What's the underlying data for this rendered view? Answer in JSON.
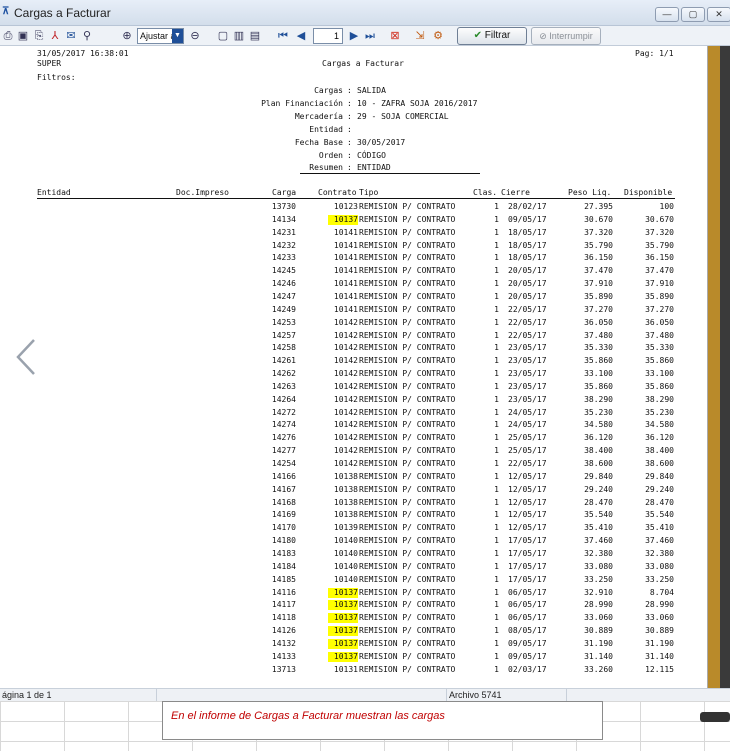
{
  "window": {
    "title": "Cargas a Facturar",
    "controls": [
      "—",
      "▢",
      "✕"
    ]
  },
  "toolbar": {
    "zoom_value": "Ajustar á",
    "page_number": "1",
    "filtrar_label": "Filtrar",
    "interrumpir_label": "Interrumpir"
  },
  "report": {
    "date_time": "31/05/2017 16:38:01",
    "user": "SUPER",
    "title": "Cargas a Facturar",
    "page": "Pag: 1/1",
    "filtros_label": "Filtros:",
    "filters": [
      {
        "label": "Cargas",
        "value": "SALIDA"
      },
      {
        "label": "Plan Financiación",
        "value": "10 - ZAFRA SOJA 2016/2017"
      },
      {
        "label": "Mercadería",
        "value": "29 - SOJA COMERCIAL"
      },
      {
        "label": "Entidad",
        "value": ""
      },
      {
        "label": "Fecha Base",
        "value": "30/05/2017"
      },
      {
        "label": "Orden",
        "value": "CÓDIGO"
      },
      {
        "label": "Resumen",
        "value": "ENTIDAD"
      }
    ],
    "columns": {
      "entidad": "Entidad",
      "doc": "Doc.Impreso",
      "carga": "Carga",
      "contrato": "Contrato",
      "tipo": "Tipo",
      "clas": "Clas.",
      "cierre": "Cierre",
      "peso": "Peso Liq.",
      "disponible": "Disponible"
    },
    "rows": [
      [
        "13730",
        "10123",
        "REMISION P/ CONTRATO",
        "1",
        "28/02/17",
        "27.395",
        "100",
        false
      ],
      [
        "14134",
        "10137",
        "REMISION P/ CONTRATO",
        "1",
        "09/05/17",
        "30.670",
        "30.670",
        true
      ],
      [
        "14231",
        "10141",
        "REMISION P/ CONTRATO",
        "1",
        "18/05/17",
        "37.320",
        "37.320",
        false
      ],
      [
        "14232",
        "10141",
        "REMISION P/ CONTRATO",
        "1",
        "18/05/17",
        "35.790",
        "35.790",
        false
      ],
      [
        "14233",
        "10141",
        "REMISION P/ CONTRATO",
        "1",
        "18/05/17",
        "36.150",
        "36.150",
        false
      ],
      [
        "14245",
        "10141",
        "REMISION P/ CONTRATO",
        "1",
        "20/05/17",
        "37.470",
        "37.470",
        false
      ],
      [
        "14246",
        "10141",
        "REMISION P/ CONTRATO",
        "1",
        "20/05/17",
        "37.910",
        "37.910",
        false
      ],
      [
        "14247",
        "10141",
        "REMISION P/ CONTRATO",
        "1",
        "20/05/17",
        "35.890",
        "35.890",
        false
      ],
      [
        "14249",
        "10141",
        "REMISION P/ CONTRATO",
        "1",
        "22/05/17",
        "37.270",
        "37.270",
        false
      ],
      [
        "14253",
        "10142",
        "REMISION P/ CONTRATO",
        "1",
        "22/05/17",
        "36.050",
        "36.050",
        false
      ],
      [
        "14257",
        "10142",
        "REMISION P/ CONTRATO",
        "1",
        "22/05/17",
        "37.480",
        "37.480",
        false
      ],
      [
        "14258",
        "10142",
        "REMISION P/ CONTRATO",
        "1",
        "23/05/17",
        "35.330",
        "35.330",
        false
      ],
      [
        "14261",
        "10142",
        "REMISION P/ CONTRATO",
        "1",
        "23/05/17",
        "35.860",
        "35.860",
        false
      ],
      [
        "14262",
        "10142",
        "REMISION P/ CONTRATO",
        "1",
        "23/05/17",
        "33.100",
        "33.100",
        false
      ],
      [
        "14263",
        "10142",
        "REMISION P/ CONTRATO",
        "1",
        "23/05/17",
        "35.860",
        "35.860",
        false
      ],
      [
        "14264",
        "10142",
        "REMISION P/ CONTRATO",
        "1",
        "23/05/17",
        "38.290",
        "38.290",
        false
      ],
      [
        "14272",
        "10142",
        "REMISION P/ CONTRATO",
        "1",
        "24/05/17",
        "35.230",
        "35.230",
        false
      ],
      [
        "14274",
        "10142",
        "REMISION P/ CONTRATO",
        "1",
        "24/05/17",
        "34.580",
        "34.580",
        false
      ],
      [
        "14276",
        "10142",
        "REMISION P/ CONTRATO",
        "1",
        "25/05/17",
        "36.120",
        "36.120",
        false
      ],
      [
        "14277",
        "10142",
        "REMISION P/ CONTRATO",
        "1",
        "25/05/17",
        "38.400",
        "38.400",
        false
      ],
      [
        "14254",
        "10142",
        "REMISION P/ CONTRATO",
        "1",
        "22/05/17",
        "38.600",
        "38.600",
        false
      ],
      [
        "14166",
        "10138",
        "REMISION P/ CONTRATO",
        "1",
        "12/05/17",
        "29.840",
        "29.840",
        false
      ],
      [
        "14167",
        "10138",
        "REMISION P/ CONTRATO",
        "1",
        "12/05/17",
        "29.240",
        "29.240",
        false
      ],
      [
        "14168",
        "10138",
        "REMISION P/ CONTRATO",
        "1",
        "12/05/17",
        "28.470",
        "28.470",
        false
      ],
      [
        "14169",
        "10138",
        "REMISION P/ CONTRATO",
        "1",
        "12/05/17",
        "35.540",
        "35.540",
        false
      ],
      [
        "14170",
        "10139",
        "REMISION P/ CONTRATO",
        "1",
        "12/05/17",
        "35.410",
        "35.410",
        false
      ],
      [
        "14180",
        "10140",
        "REMISION P/ CONTRATO",
        "1",
        "17/05/17",
        "37.460",
        "37.460",
        false
      ],
      [
        "14183",
        "10140",
        "REMISION P/ CONTRATO",
        "1",
        "17/05/17",
        "32.380",
        "32.380",
        false
      ],
      [
        "14184",
        "10140",
        "REMISION P/ CONTRATO",
        "1",
        "17/05/17",
        "33.080",
        "33.080",
        false
      ],
      [
        "14185",
        "10140",
        "REMISION P/ CONTRATO",
        "1",
        "17/05/17",
        "33.250",
        "33.250",
        false
      ],
      [
        "14116",
        "10137",
        "REMISION P/ CONTRATO",
        "1",
        "06/05/17",
        "32.910",
        "8.704",
        true
      ],
      [
        "14117",
        "10137",
        "REMISION P/ CONTRATO",
        "1",
        "06/05/17",
        "28.990",
        "28.990",
        true
      ],
      [
        "14118",
        "10137",
        "REMISION P/ CONTRATO",
        "1",
        "06/05/17",
        "33.060",
        "33.060",
        true
      ],
      [
        "14126",
        "10137",
        "REMISION P/ CONTRATO",
        "1",
        "08/05/17",
        "30.889",
        "30.889",
        true
      ],
      [
        "14132",
        "10137",
        "REMISION P/ CONTRATO",
        "1",
        "09/05/17",
        "31.190",
        "31.190",
        true
      ],
      [
        "14133",
        "10137",
        "REMISION P/ CONTRATO",
        "1",
        "09/05/17",
        "31.140",
        "31.140",
        true
      ],
      [
        "13713",
        "10131",
        "REMISION P/ CONTRATO",
        "1",
        "02/03/17",
        "33.260",
        "12.115",
        false
      ]
    ],
    "highlight_color": "#ffff00"
  },
  "status": {
    "page_info": "ágina 1 de 1",
    "archive": "Archivo 5741"
  },
  "caption": {
    "text": "En el informe de Cargas a Facturar muestran las cargas",
    "color": "#c00000"
  }
}
